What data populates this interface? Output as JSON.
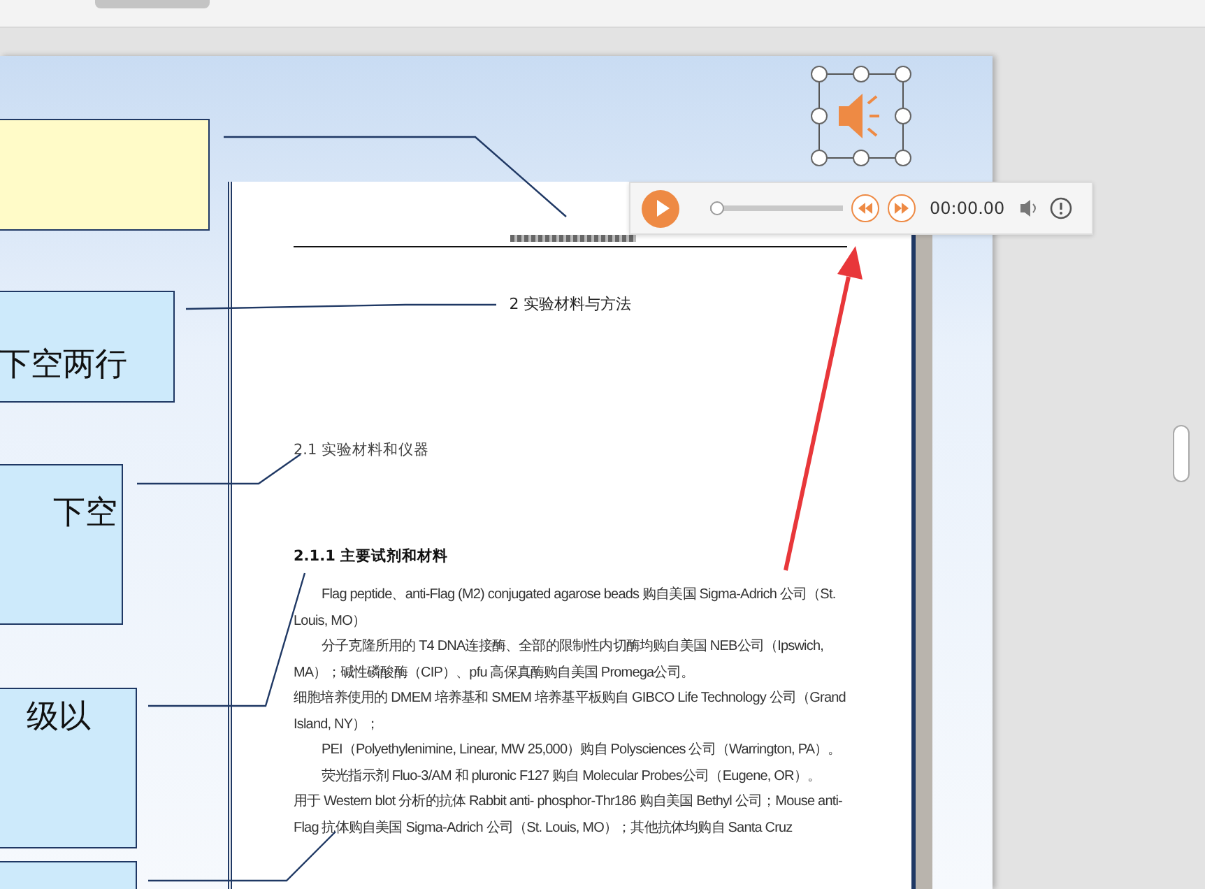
{
  "slide": {
    "callouts": [
      {
        "color": "#fffbc8"
      },
      {
        "color": "#cdeafb",
        "lines": [
          "下空两行"
        ]
      },
      {
        "color": "#cdeafb",
        "lines": [
          "下空"
        ]
      },
      {
        "color": "#cdeafb",
        "lines": [
          "级以"
        ]
      },
      {
        "color": "#cdeafb"
      }
    ]
  },
  "document": {
    "chapter_heading": "2  实验材料与方法",
    "section_heading": "2.1  实验材料和仪器",
    "subsection_heading": "2.1.1 主要试剂和材料",
    "paragraphs": [
      {
        "indented": true,
        "text": "Flag peptide、anti-Flag (M2) conjugated agarose beads 购自美国 Sigma-Adrich 公司（St. Louis, MO）"
      },
      {
        "indented": true,
        "text": "分子克隆所用的 T4 DNA连接酶、全部的限制性内切酶均购自美国 NEB公司（Ipswich, MA）；碱性磷酸酶（CIP）、pfu 高保真酶购自美国 Promega公司。"
      },
      {
        "indented": false,
        "text": "细胞培养使用的 DMEM 培养基和 SMEM 培养基平板购自 GIBCO Life Technology 公司（Grand Island, NY）；"
      },
      {
        "indented": true,
        "text": "PEI（Polyethylenimine, Linear, MW 25,000）购自 Polysciences 公司（Warrington, PA）。"
      },
      {
        "indented": true,
        "text": "荧光指示剂 Fluo-3/AM 和 pluronic F127 购自 Molecular Probes公司（Eugene, OR）。"
      },
      {
        "indented": false,
        "text": "用于 Western blot 分析的抗体 Rabbit anti- phosphor-Thr186 购自美国 Bethyl 公司；Mouse anti-Flag 抗体购自美国 Sigma-Adrich 公司（St. Louis, MO）；其他抗体均购自 Santa Cruz"
      }
    ]
  },
  "audio_player": {
    "time": "00:00.00",
    "level": 0
  }
}
